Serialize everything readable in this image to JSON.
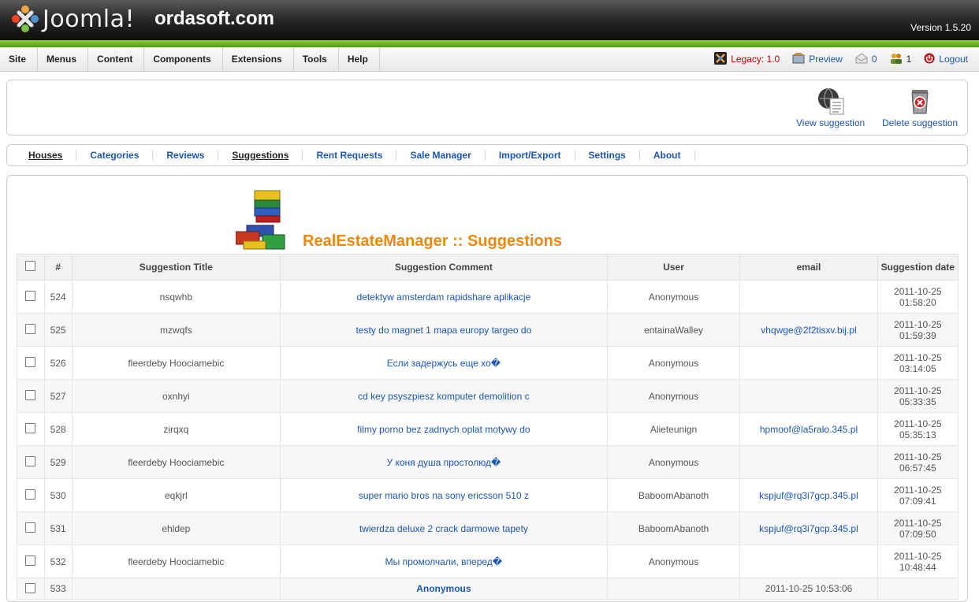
{
  "header": {
    "logo_text": "Joomla!",
    "site_name": "ordasoft.com",
    "version": "Version 1.5.20"
  },
  "menu": {
    "items": [
      "Site",
      "Menus",
      "Content",
      "Components",
      "Extensions",
      "Tools",
      "Help"
    ]
  },
  "status": {
    "legacy": "Legacy: 1.0",
    "preview": "Preview",
    "messages_count": "0",
    "users_online": "1",
    "logout": "Logout"
  },
  "toolbar": {
    "view_label": "View suggestion",
    "delete_label": "Delete suggestion"
  },
  "submenu": {
    "items": [
      "Houses",
      "Categories",
      "Reviews",
      "Suggestions",
      "Rent Requests",
      "Sale Manager",
      "Import/Export",
      "Settings",
      "About"
    ]
  },
  "page": {
    "title": "RealEstateManager :: Suggestions"
  },
  "table": {
    "headers": [
      "#",
      "Suggestion Title",
      "Suggestion Comment",
      "User",
      "email",
      "Suggestion date"
    ],
    "rows": [
      {
        "id": "524",
        "title": "nsqwhb",
        "comment": "detektyw amsterdam rapidshare aplikacje",
        "user": "Anonymous",
        "email": "",
        "date1": "2011-10-25",
        "date2": "01:58:20"
      },
      {
        "id": "525",
        "title": "mzwqfs",
        "comment": "testy do magnet 1 mapa europy targeo do",
        "user": "entainaWalley",
        "email": "vhqwge@2f2tisxv.bij.pl",
        "date1": "2011-10-25",
        "date2": "01:59:39"
      },
      {
        "id": "526",
        "title": "fleerdeby Hoociamebic",
        "comment": "Если задержусь еще хо�",
        "user": "Anonymous",
        "email": "",
        "date1": "2011-10-25",
        "date2": "03:14:05"
      },
      {
        "id": "527",
        "title": "oxnhyi",
        "comment": "cd key psyszpiesz komputer demolition c",
        "user": "Anonymous",
        "email": "",
        "date1": "2011-10-25",
        "date2": "05:33:35"
      },
      {
        "id": "528",
        "title": "zirqxq",
        "comment": "filmy porno bez zadnych oplat motywy do",
        "user": "Alieteunign",
        "email": "hpmoof@la5ralo.345.pl",
        "date1": "2011-10-25",
        "date2": "05:35:13"
      },
      {
        "id": "529",
        "title": "fleerdeby Hoociamebic",
        "comment": "У коня душа простолюд�",
        "user": "Anonymous",
        "email": "",
        "date1": "2011-10-25",
        "date2": "06:57:45"
      },
      {
        "id": "530",
        "title": "eqkjrl",
        "comment": "super mario bros na sony ericsson 510 z",
        "user": "BaboomAbanoth",
        "email": "kspjuf@rq3i7gcp.345.pl",
        "date1": "2011-10-25",
        "date2": "07:09:41"
      },
      {
        "id": "531",
        "title": "ehldep",
        "comment": "twierdza deluxe 2 crack darmowe tapety",
        "user": "BaboomAbanoth",
        "email": "kspjuf@rq3i7gcp.345.pl",
        "date1": "2011-10-25",
        "date2": "07:09:50"
      },
      {
        "id": "532",
        "title": "fleerdeby Hoociamebic",
        "comment": "Мы промолчали, вперед�",
        "user": "Anonymous",
        "email": "",
        "date1": "2011-10-25",
        "date2": "10:48:44"
      }
    ],
    "last_row": {
      "id": "533",
      "comment": "Anonymous",
      "email": "2011-10-25 10:53:06"
    }
  },
  "colors": {
    "accent_green": "#6cb825",
    "title_orange": "#f0880a",
    "link_blue": "#1b57b1"
  }
}
